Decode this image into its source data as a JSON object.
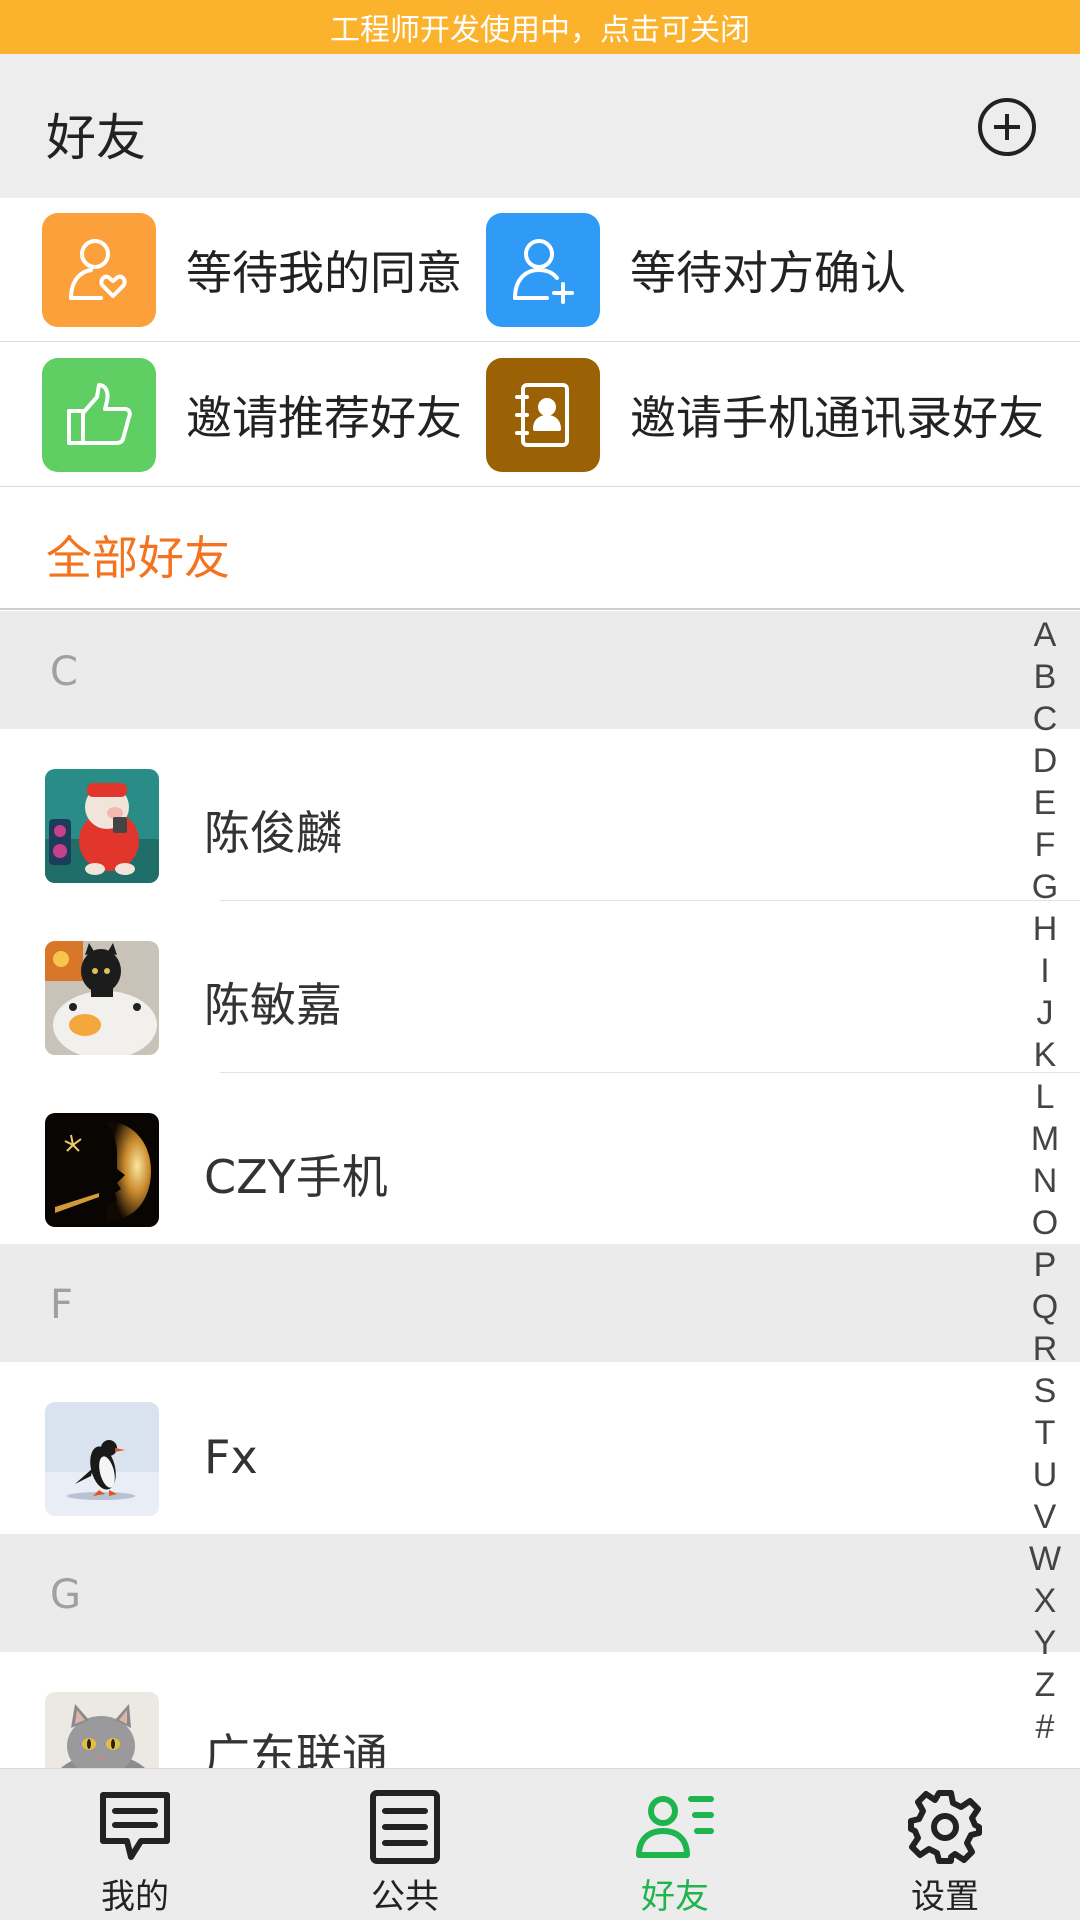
{
  "banner": {
    "text": "工程师开发使用中，点击可关闭"
  },
  "header": {
    "title": "好友"
  },
  "actions": [
    {
      "label": "等待我的同意",
      "icon": "person-heart-icon",
      "color": "#fca03c"
    },
    {
      "label": "等待对方确认",
      "icon": "person-add-icon",
      "color": "#2f9bf7"
    },
    {
      "label": "邀请推荐好友",
      "icon": "thumbs-up-icon",
      "color": "#5fcf64"
    },
    {
      "label": "邀请手机通讯录好友",
      "icon": "contact-book-icon",
      "color": "#9a6204"
    }
  ],
  "all_friends": {
    "label": "全部好友"
  },
  "sections": [
    {
      "letter": "C",
      "contacts": [
        {
          "name": "陈俊麟",
          "avatar": "red-pig-toy-avatar"
        },
        {
          "name": "陈敏嘉",
          "avatar": "black-cat-pillow-avatar"
        },
        {
          "name": "CZY手机",
          "avatar": "golden-silhouette-avatar"
        }
      ]
    },
    {
      "letter": "F",
      "contacts": [
        {
          "name": "Fx",
          "avatar": "penguin-avatar"
        }
      ]
    },
    {
      "letter": "G",
      "contacts": [
        {
          "name": "广东联通",
          "avatar": "grey-cat-avatar"
        }
      ]
    }
  ],
  "alpha_index": [
    "A",
    "B",
    "C",
    "D",
    "E",
    "F",
    "G",
    "H",
    "I",
    "J",
    "K",
    "L",
    "M",
    "N",
    "O",
    "P",
    "Q",
    "R",
    "S",
    "T",
    "U",
    "V",
    "W",
    "X",
    "Y",
    "Z",
    "#"
  ],
  "tabs": [
    {
      "label": "我的",
      "icon": "chat-bubble-icon",
      "active": false
    },
    {
      "label": "公共",
      "icon": "list-document-icon",
      "active": false
    },
    {
      "label": "好友",
      "icon": "friends-list-icon",
      "active": true
    },
    {
      "label": "设置",
      "icon": "gear-icon",
      "active": false
    }
  ],
  "colors": {
    "accent": "#f3731f",
    "active_tab": "#1fb44e",
    "banner": "#fbb22c"
  }
}
